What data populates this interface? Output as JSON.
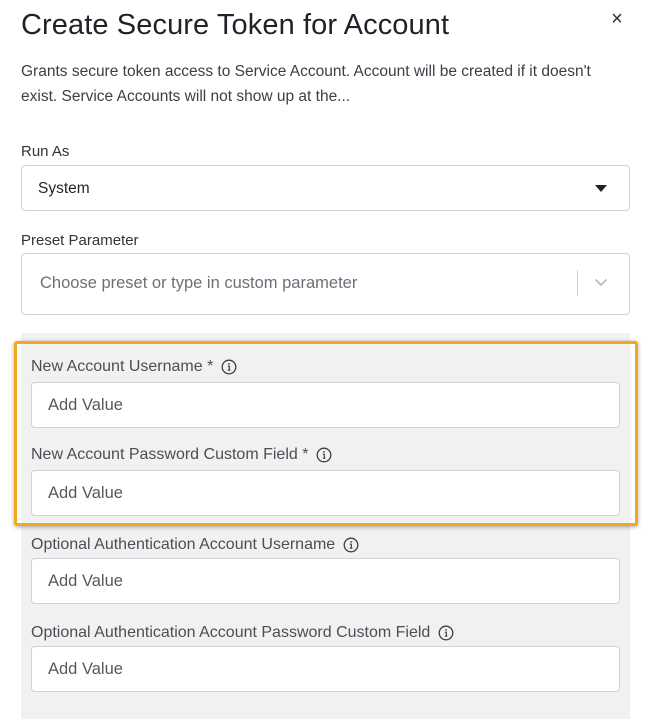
{
  "dialog": {
    "title": "Create Secure Token for Account",
    "close_icon": "×",
    "description": "Grants secure token access to Service Account. Account will be created if it doesn't exist. Service Accounts will not show up at the..."
  },
  "run_as": {
    "label": "Run As",
    "value": "System"
  },
  "preset": {
    "label": "Preset Parameter",
    "placeholder": "Choose preset or type in custom parameter"
  },
  "fields": [
    {
      "label": "New Account Username *",
      "placeholder": "Add Value"
    },
    {
      "label": "New Account Password Custom Field *",
      "placeholder": "Add Value"
    },
    {
      "label": "Optional Authentication Account Username",
      "placeholder": "Add Value"
    },
    {
      "label": "Optional Authentication Account Password Custom Field",
      "placeholder": "Add Value"
    }
  ],
  "colors": {
    "highlight": "#f2a81d",
    "panel_bg": "#f1f1f1"
  }
}
